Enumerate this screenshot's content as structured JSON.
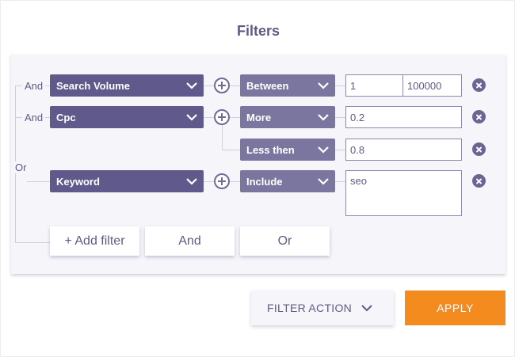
{
  "title": "Filters",
  "connectors": {
    "and1": "And",
    "and2": "And",
    "or": "Or"
  },
  "rows": [
    {
      "field": "Search Volume",
      "operator": "Between",
      "value_from": "1",
      "value_to": "100000"
    },
    {
      "field": "Cpc",
      "operator": "More",
      "value": "0.2",
      "sub_operator": "Less then",
      "sub_value": "0.8"
    },
    {
      "field": "Keyword",
      "operator": "Include",
      "value": "seo"
    }
  ],
  "buttons": {
    "add_filter": "+ Add filter",
    "and": "And",
    "or": "Or"
  },
  "filter_action": {
    "label": "FILTER ACTION"
  },
  "apply": {
    "label": "APPLY"
  },
  "colors": {
    "primary": "#5f5a8b",
    "secondary": "#7b769f",
    "accent": "#f48b1f",
    "panel": "#f5f5fa"
  },
  "icons": {
    "dropdown": "chevron-down-icon",
    "add_condition": "plus-circle-icon",
    "remove": "close-circle-icon"
  }
}
